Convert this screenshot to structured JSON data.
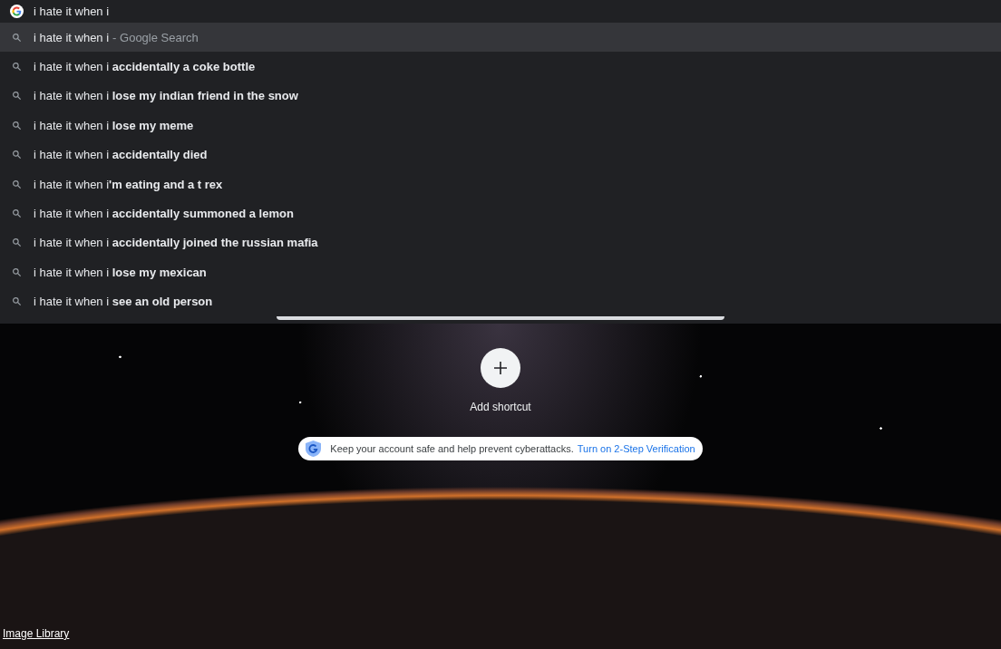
{
  "omnibox": {
    "value": "i hate it when i"
  },
  "suggestions": [
    {
      "text": "i hate it when i",
      "suffix": "- Google Search",
      "selected": true
    },
    {
      "text": "i hate it when i **accidentally a coke bottle**",
      "selected": false
    },
    {
      "text": "i hate it when i **lose my indian friend in the snow**",
      "selected": false
    },
    {
      "text": "i hate it when i **lose my meme**",
      "selected": false
    },
    {
      "text": "i hate it when i **accidentally died**",
      "selected": false
    },
    {
      "text": "i hate it when i**'m eating and a t rex**",
      "selected": false
    },
    {
      "text": "i hate it when i **accidentally summoned a lemon**",
      "selected": false
    },
    {
      "text": "i hate it when i **accidentally joined the russian mafia**",
      "selected": false
    },
    {
      "text": "i hate it when i **lose my mexican**",
      "selected": false
    },
    {
      "text": "i hate it when i **see an old person**",
      "selected": false
    }
  ],
  "shortcut": {
    "label": "Add shortcut"
  },
  "promo": {
    "text": "Keep your account safe and help prevent cyberattacks.",
    "link": "Turn on 2-Step Verification"
  },
  "footer_link": "Image Library"
}
